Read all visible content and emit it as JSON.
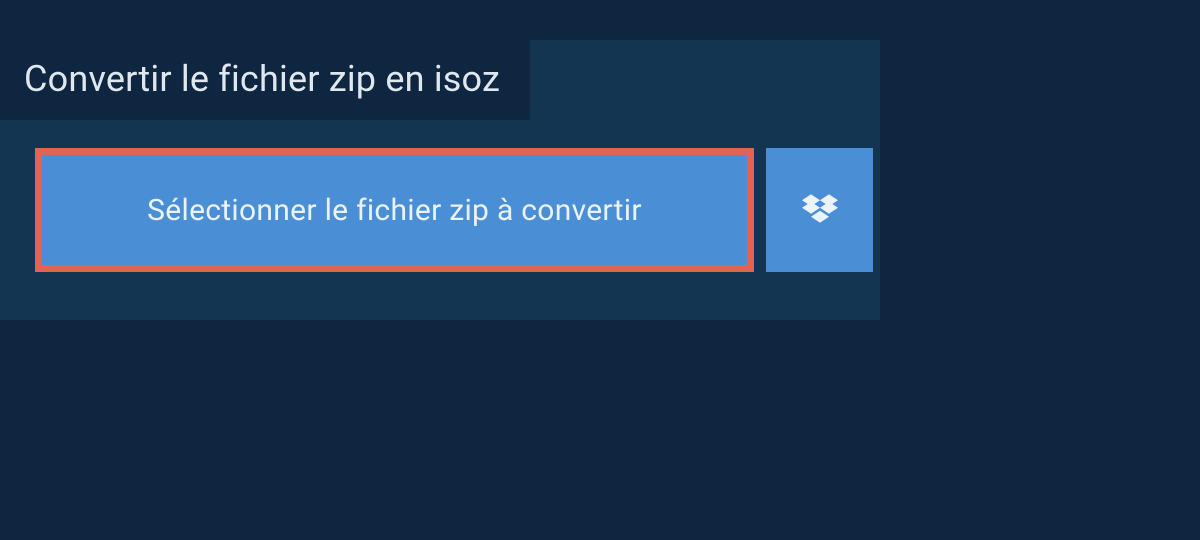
{
  "page": {
    "title": "Convertir le fichier zip en isoz"
  },
  "actions": {
    "select_file_label": "Sélectionner le fichier zip à convertir",
    "dropbox_icon": "dropbox-icon"
  },
  "colors": {
    "bg_outer": "#0f2640",
    "bg_panel": "#143552",
    "button_blue": "#4a8fd6",
    "highlight_border": "#e06353",
    "text_light": "#eaf2fa"
  }
}
